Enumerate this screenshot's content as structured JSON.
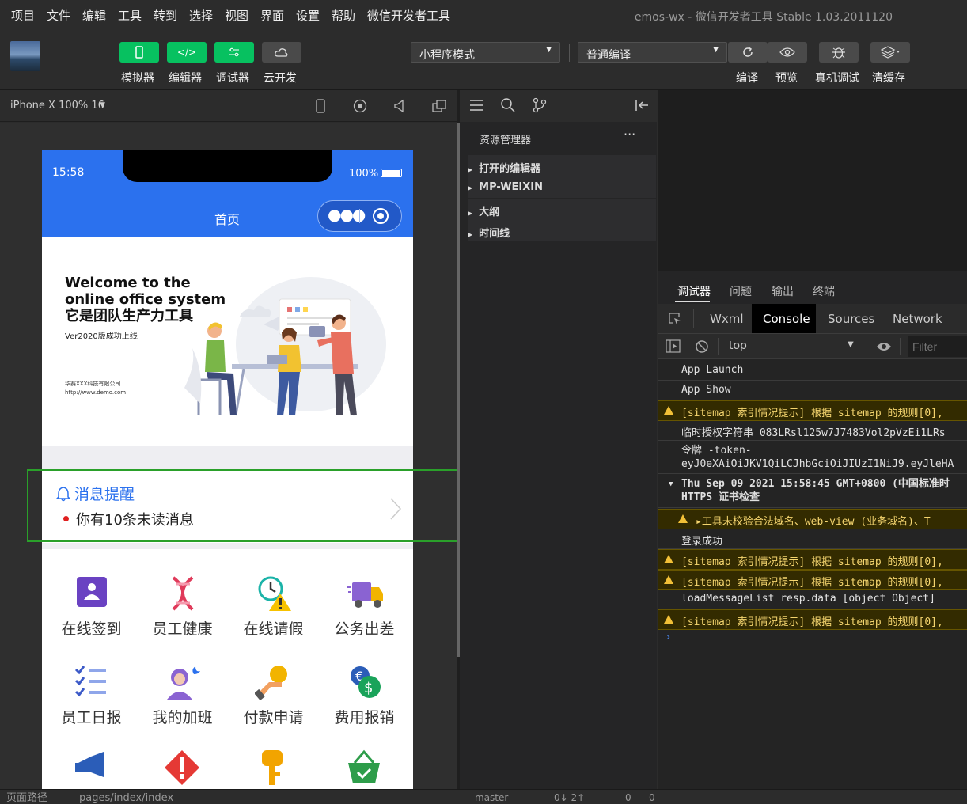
{
  "menu": [
    "项目",
    "文件",
    "编辑",
    "工具",
    "转到",
    "选择",
    "视图",
    "界面",
    "设置",
    "帮助",
    "微信开发者工具"
  ],
  "window_title": "emos-wx - 微信开发者工具 Stable 1.03.2011120",
  "toolbar": {
    "simulator": "模拟器",
    "editor": "编辑器",
    "debugger": "调试器",
    "cloud": "云开发",
    "mode_select": "小程序模式",
    "compile_select": "普通编译",
    "compile": "编译",
    "preview": "预览",
    "device_debug": "真机调试",
    "clear_cache": "清缓存",
    "green_color": "#07c160"
  },
  "simulator": {
    "device": "iPhone X 100% 16",
    "time": "15:58",
    "battery": "100%",
    "nav_title": "首页",
    "nav_color": "#2b71ee"
  },
  "banner": {
    "line1": "Welcome to the",
    "line2": "online office system",
    "line3": "它是团队生产力工具",
    "version": "Ver2020版成功上线",
    "company": "华赛XXX科技有限公司",
    "url": "http://www.demo.com"
  },
  "message": {
    "title": "消息提醒",
    "text": "你有10条未读消息"
  },
  "grid": [
    {
      "label": "在线签到",
      "icon": "sign-in-icon"
    },
    {
      "label": "员工健康",
      "icon": "dna-icon"
    },
    {
      "label": "在线请假",
      "icon": "clock-warning-icon"
    },
    {
      "label": "公务出差",
      "icon": "truck-icon"
    },
    {
      "label": "员工日报",
      "icon": "checklist-icon"
    },
    {
      "label": "我的加班",
      "icon": "person-moon-icon"
    },
    {
      "label": "付款申请",
      "icon": "hand-coin-icon"
    },
    {
      "label": "费用报销",
      "icon": "money-icon"
    }
  ],
  "explorer": {
    "title": "资源管理器",
    "items": [
      "打开的编辑器",
      "MP-WEIXIN",
      "大纲",
      "时间线"
    ]
  },
  "debugger_tabs": [
    "调试器",
    "问题",
    "输出",
    "终端"
  ],
  "devtools_tabs": [
    "Wxml",
    "Console",
    "Sources",
    "Network"
  ],
  "console_toolbar": {
    "context": "top",
    "filter_placeholder": "Filter"
  },
  "console": [
    {
      "type": "log",
      "text": "App Launch"
    },
    {
      "type": "log",
      "text": "App Show"
    },
    {
      "type": "warn",
      "text": "[sitemap 索引情况提示] 根据 sitemap 的规则[0],"
    },
    {
      "type": "log",
      "text": "临时授权字符串 083LRsl125w7J7483Vol2pVzEi1LRs"
    },
    {
      "type": "log2",
      "text": "令牌 -token-",
      "text2": "eyJ0eXAiOiJKV1QiLCJhbGciOiJIUzI1NiJ9.eyJleHA"
    },
    {
      "type": "group",
      "text": "Thu Sep 09 2021 15:58:45 GMT+0800 (中国标准时",
      "text2": "HTTPS 证书检查"
    },
    {
      "type": "warn-sub",
      "text": "▸工具未校验合法域名、web-view (业务域名)、T"
    },
    {
      "type": "log",
      "text": "登录成功"
    },
    {
      "type": "warn",
      "text": "[sitemap 索引情况提示] 根据 sitemap 的规则[0],"
    },
    {
      "type": "warn",
      "text": "[sitemap 索引情况提示] 根据 sitemap 的规则[0],"
    },
    {
      "type": "log",
      "text": "loadMessageList resp.data [object Object]"
    },
    {
      "type": "warn",
      "text": "[sitemap 索引情况提示] 根据 sitemap 的规则[0],"
    }
  ],
  "statusbar": {
    "page_path_label": "页面路径",
    "page_path": "pages/index/index",
    "branch": "master",
    "sync": "0↓ 2↑",
    "errors": "0",
    "warnings": "0"
  }
}
